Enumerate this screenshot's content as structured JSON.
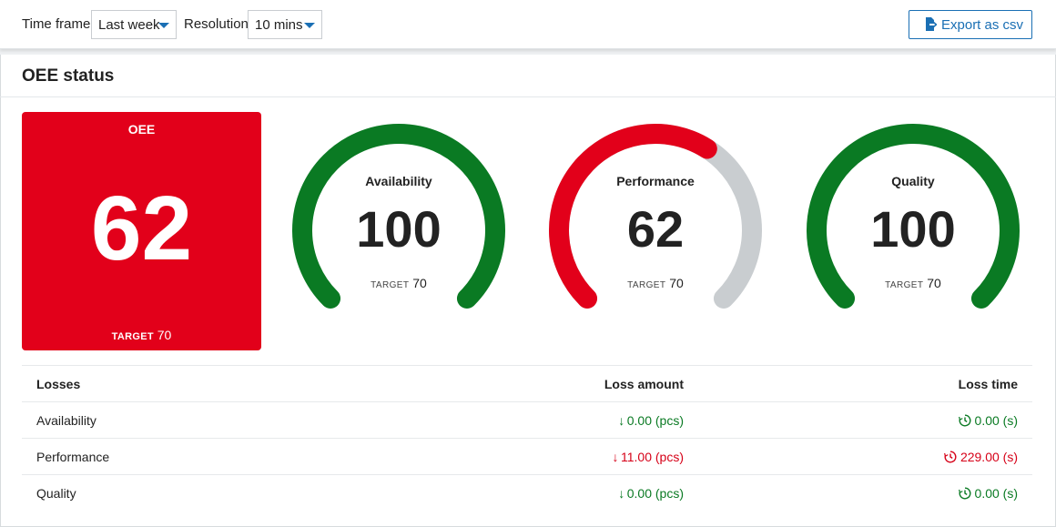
{
  "toolbar": {
    "time_frame_label": "Time frame",
    "time_frame_value": "Last week",
    "resolution_label": "Resolution",
    "resolution_value": "10 mins",
    "export_label": "Export as csv"
  },
  "section": {
    "title": "OEE status"
  },
  "oee": {
    "title": "OEE",
    "value": "62",
    "target_label": "TARGET",
    "target": "70",
    "color": "#e2001a"
  },
  "gauges": [
    {
      "name": "Availability",
      "value": "100",
      "target_label": "TARGET",
      "target": "70",
      "fraction": 1.0,
      "color": "#0a7a23"
    },
    {
      "name": "Performance",
      "value": "62",
      "target_label": "TARGET",
      "target": "70",
      "fraction": 0.62,
      "color": "#e2001a"
    },
    {
      "name": "Quality",
      "value": "100",
      "target_label": "TARGET",
      "target": "70",
      "fraction": 1.0,
      "color": "#0a7a23"
    }
  ],
  "colors": {
    "accent": "#1a6fb4",
    "track": "#c9cdd0",
    "good": "#0a7a23",
    "bad": "#e2001a"
  },
  "losses": {
    "headers": [
      "Losses",
      "Loss amount",
      "Loss time"
    ],
    "rows": [
      {
        "name": "Availability",
        "amount": "0.00 (pcs)",
        "time": "0.00 (s)",
        "status": "good"
      },
      {
        "name": "Performance",
        "amount": "11.00 (pcs)",
        "time": "229.00 (s)",
        "status": "bad"
      },
      {
        "name": "Quality",
        "amount": "0.00 (pcs)",
        "time": "0.00 (s)",
        "status": "good"
      }
    ]
  }
}
